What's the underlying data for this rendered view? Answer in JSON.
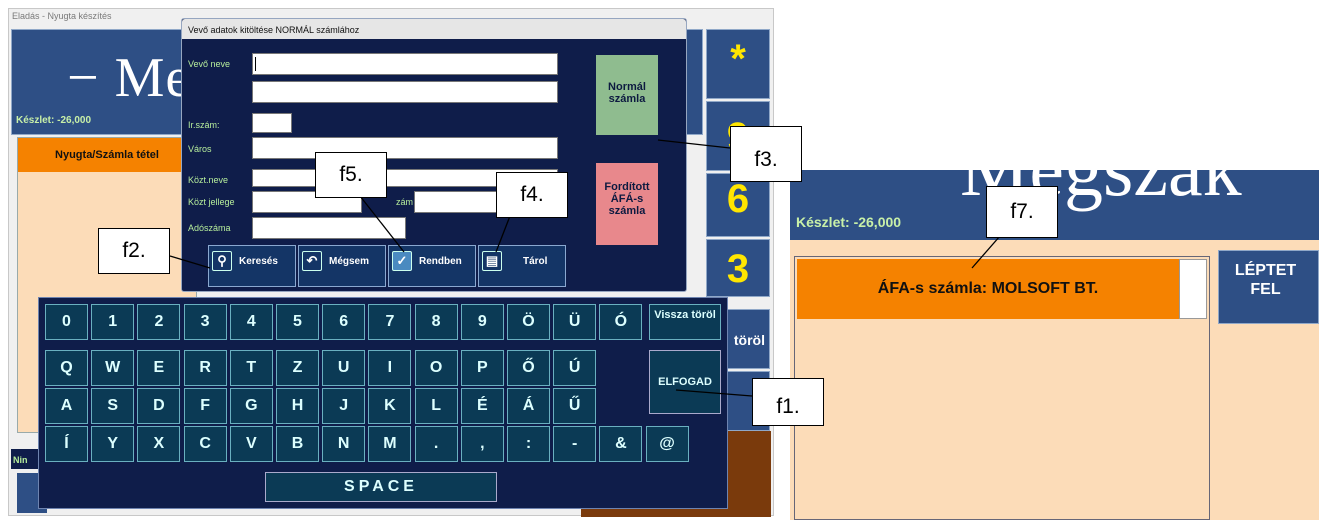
{
  "window": {
    "title": "Eladás - Nyugta készítés"
  },
  "header": {
    "big_text": "− Me",
    "stock": "Készlet: -26,000"
  },
  "left_panel": {
    "header": "Nyugta/Számla tétel",
    "status": "Nin"
  },
  "numpad": {
    "star": "*",
    "k9": "9",
    "k6": "6",
    "k3": "3",
    "torol": "töröl"
  },
  "dialog": {
    "title": "Vevő adatok kitöltése NORMÁL számlához",
    "labels": {
      "name": "Vevő neve",
      "zip": "Ir.szám:",
      "city": "Város",
      "street": "Közt.neve",
      "street_type": "Közt jellege",
      "number": "zám",
      "tax": "Adószáma"
    },
    "values": {
      "name": "",
      "name2": "",
      "zip": "",
      "city": "",
      "street": "",
      "street_type": "",
      "number": "",
      "tax": ""
    },
    "buttons": {
      "search": "Keresés",
      "cancel": "Mégsem",
      "ok": "Rendben",
      "store": "Tárol"
    },
    "normal": "Normál számla",
    "reverse": "Fordított ÁFÁ-s számla"
  },
  "keyboard": {
    "row1": [
      "0",
      "1",
      "2",
      "3",
      "4",
      "5",
      "6",
      "7",
      "8",
      "9",
      "Ö",
      "Ü",
      "Ó"
    ],
    "row2": [
      "Q",
      "W",
      "E",
      "R",
      "T",
      "Z",
      "U",
      "I",
      "O",
      "P",
      "Ő",
      "Ú"
    ],
    "row3": [
      "A",
      "S",
      "D",
      "F",
      "G",
      "H",
      "J",
      "K",
      "L",
      "É",
      "Á",
      "Ű"
    ],
    "row4": [
      "Í",
      "Y",
      "X",
      "C",
      "V",
      "B",
      "N",
      "M",
      ".",
      ",",
      ":",
      "-",
      "&",
      "@"
    ],
    "backspace": "Vissza töröl",
    "accept": "ELFOGAD",
    "space": "SPACE"
  },
  "right": {
    "stock": "Készlet: -26,000",
    "header": "ÁFA-s számla: MOLSOFT BT.",
    "step": "LÉPTET FEL",
    "big_text": "Megszak"
  },
  "callouts": {
    "f1": "f1.",
    "f2": "f2.",
    "f3": "f3.",
    "f4": "f4.",
    "f5": "f5.",
    "f7": "f7."
  },
  "colors": {
    "dark_blue": "#2e4f85",
    "navy": "#0f1d4a",
    "orange": "#f58200",
    "peach": "#fcdcb8",
    "green": "#8fbc8f",
    "pink": "#e8888c"
  }
}
